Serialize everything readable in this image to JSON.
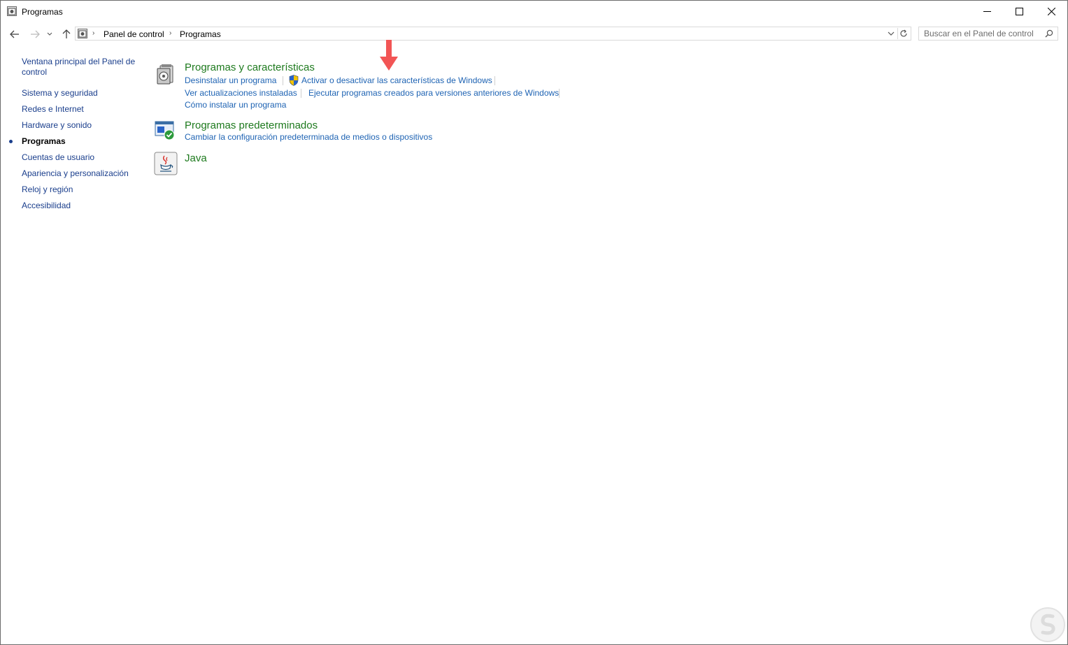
{
  "window": {
    "title": "Programas"
  },
  "address": {
    "crumbs": [
      "Panel de control",
      "Programas"
    ]
  },
  "search": {
    "placeholder": "Buscar en el Panel de control"
  },
  "sidebar": {
    "items": [
      {
        "label": "Ventana principal del Panel de"
      },
      {
        "label": "control"
      },
      {
        "label": "Sistema y seguridad"
      },
      {
        "label": "Redes e Internet"
      },
      {
        "label": "Hardware y sonido"
      },
      {
        "label": "Programas"
      },
      {
        "label": "Cuentas de usuario"
      },
      {
        "label": "Apariencia y personalización"
      },
      {
        "label": "Reloj y región"
      },
      {
        "label": "Accesibilidad"
      }
    ]
  },
  "categories": {
    "programs": {
      "title": "Programas y características",
      "links": [
        "Desinstalar un programa",
        "Activar o desactivar las características de Windows",
        "Ver actualizaciones instaladas",
        "Ejecutar programas creados para versiones anteriores de Windows",
        "Cómo instalar un programa"
      ]
    },
    "defaults": {
      "title": "Programas predeterminados",
      "links": [
        "Cambiar la configuración predeterminada de medios o dispositivos"
      ]
    },
    "java": {
      "title": "Java"
    }
  },
  "colors": {
    "link": "#1e63b3",
    "category_title": "#1e7a1e",
    "sidebar_link": "#1a3e8c",
    "annotation_arrow": "#f25555"
  },
  "icons": {
    "title": "control-panel-icon",
    "back": "arrow-left-icon",
    "forward": "arrow-right-icon",
    "recent": "chevron-down-icon",
    "up": "arrow-up-icon",
    "refresh": "refresh-icon",
    "search": "search-icon",
    "shield": "uac-shield-icon",
    "programs": "programs-features-icon",
    "defaults": "default-programs-icon",
    "java": "java-icon"
  }
}
